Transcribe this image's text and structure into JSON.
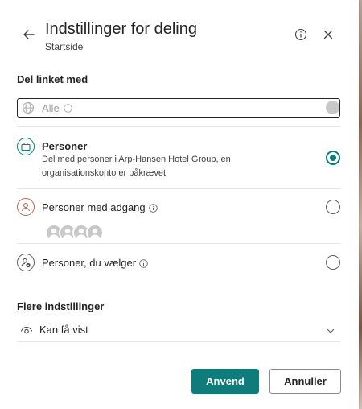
{
  "header": {
    "title": "Indstillinger for deling",
    "subtitle": "Startside"
  },
  "share_section": {
    "label": "Del linket med",
    "options": [
      {
        "key": "alle",
        "label": "Alle",
        "state": "disabled"
      },
      {
        "key": "personer",
        "label": "Personer",
        "description": "Del med personer i Arp-Hansen Hotel Group, en organisationskonto er påkrævet",
        "state": "selected"
      },
      {
        "key": "personer-med-adgang",
        "label": "Personer med adgang",
        "state": "unselected"
      },
      {
        "key": "personer-du-vaelger",
        "label": "Personer, du vælger",
        "state": "unselected"
      }
    ]
  },
  "more_settings": {
    "label": "Flere indstillinger",
    "permission": "Kan få vist"
  },
  "footer": {
    "apply_label": "Anvend",
    "cancel_label": "Annuller"
  },
  "colors": {
    "accent": "#0f7b7b",
    "text": "#242424",
    "disabled_text": "#a0a0a0"
  },
  "icons": {
    "back": "arrow-left-icon",
    "info": "info-icon",
    "close": "close-icon",
    "alle": "globe-icon",
    "personer": "briefcase-icon",
    "personer_med_adgang": "person-icon",
    "personer_du_vaelger": "person-settings-icon",
    "permission": "eye-icon",
    "dropdown": "chevron-down-icon"
  }
}
